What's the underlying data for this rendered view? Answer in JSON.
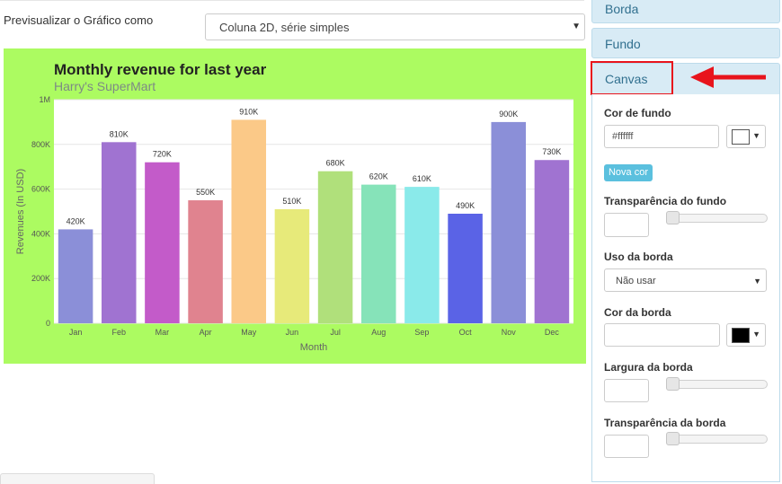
{
  "preview": {
    "label": "Previsualizar o Gráfico como",
    "selected": "Coluna 2D, série simples"
  },
  "panel": {
    "sections": [
      "Borda",
      "Fundo",
      "Canvas"
    ],
    "canvas": {
      "bg_color_label": "Cor de fundo",
      "bg_color_value": "#ffffff",
      "bg_swatch": "#ffffff",
      "new_color_button": "Nova cor",
      "bg_transparency_label": "Transparência do fundo",
      "border_use_label": "Uso da borda",
      "border_use_value": "Não usar",
      "border_color_label": "Cor da borda",
      "border_swatch": "#000000",
      "border_width_label": "Largura da borda",
      "border_transparency_label": "Transparência da borda"
    }
  },
  "chart_data": {
    "type": "bar",
    "title": "Monthly revenue for last year",
    "subtitle": "Harry's SuperMart",
    "xlabel": "Month",
    "ylabel": "Revenues (In USD)",
    "ylim": [
      0,
      1000000
    ],
    "yticks": [
      0,
      200000,
      400000,
      600000,
      800000,
      1000000
    ],
    "ytick_labels": [
      "0",
      "200K",
      "400K",
      "600K",
      "800K",
      "1M"
    ],
    "background": "#acfb61",
    "categories": [
      "Jan",
      "Feb",
      "Mar",
      "Apr",
      "May",
      "Jun",
      "Jul",
      "Aug",
      "Sep",
      "Oct",
      "Nov",
      "Dec"
    ],
    "values": [
      420000,
      810000,
      720000,
      550000,
      910000,
      510000,
      680000,
      620000,
      610000,
      490000,
      900000,
      730000
    ],
    "value_labels": [
      "420K",
      "810K",
      "720K",
      "550K",
      "910K",
      "510K",
      "680K",
      "620K",
      "610K",
      "490K",
      "900K",
      "730K"
    ],
    "colors": [
      "#8b8fd8",
      "#a073d1",
      "#c35bc9",
      "#e0838f",
      "#fbc988",
      "#e7ea7a",
      "#b0e07b",
      "#86e3b9",
      "#8aeaea",
      "#5a63e6",
      "#8b8fd8",
      "#a073d1"
    ]
  }
}
